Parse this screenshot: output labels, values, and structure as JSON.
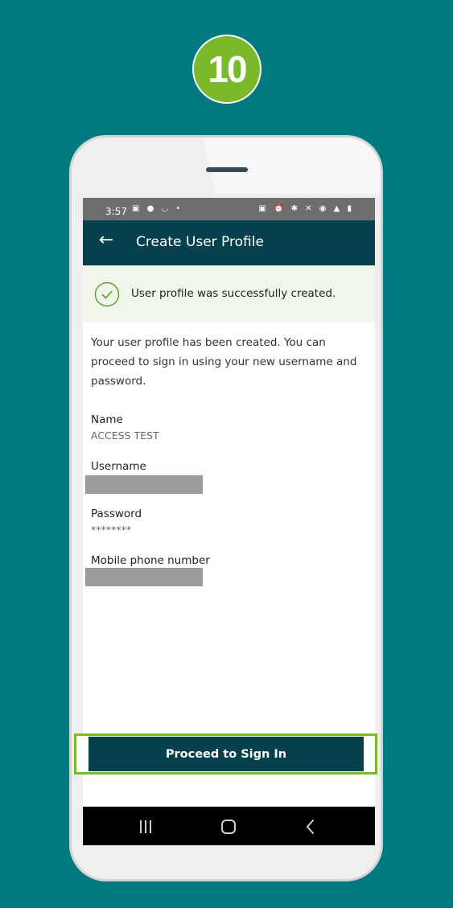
{
  "step": {
    "number": "10",
    "color": "#7ab929"
  },
  "status_bar": {
    "time": "3:57",
    "left_icons": "▣ ● ◡ •",
    "right_icons": "▣ ⏰ ✱ ✕ ◉ ▲ ▮"
  },
  "app_bar": {
    "back_icon": "←",
    "title": "Create User Profile"
  },
  "success": {
    "message": "User profile was successfully created."
  },
  "intro": "Your user profile has been created. You can proceed to sign in using your new username and password.",
  "fields": {
    "name": {
      "label": "Name",
      "value": "ACCESS TEST"
    },
    "username": {
      "label": "Username"
    },
    "password": {
      "label": "Password",
      "value": "********"
    },
    "mobile": {
      "label": "Mobile phone number"
    }
  },
  "actions": {
    "proceed_label": "Proceed to Sign In"
  },
  "colors": {
    "background": "#007a80",
    "app_bar": "#06404c",
    "success_bg": "#f0f6e9",
    "highlight": "#7ab929"
  }
}
